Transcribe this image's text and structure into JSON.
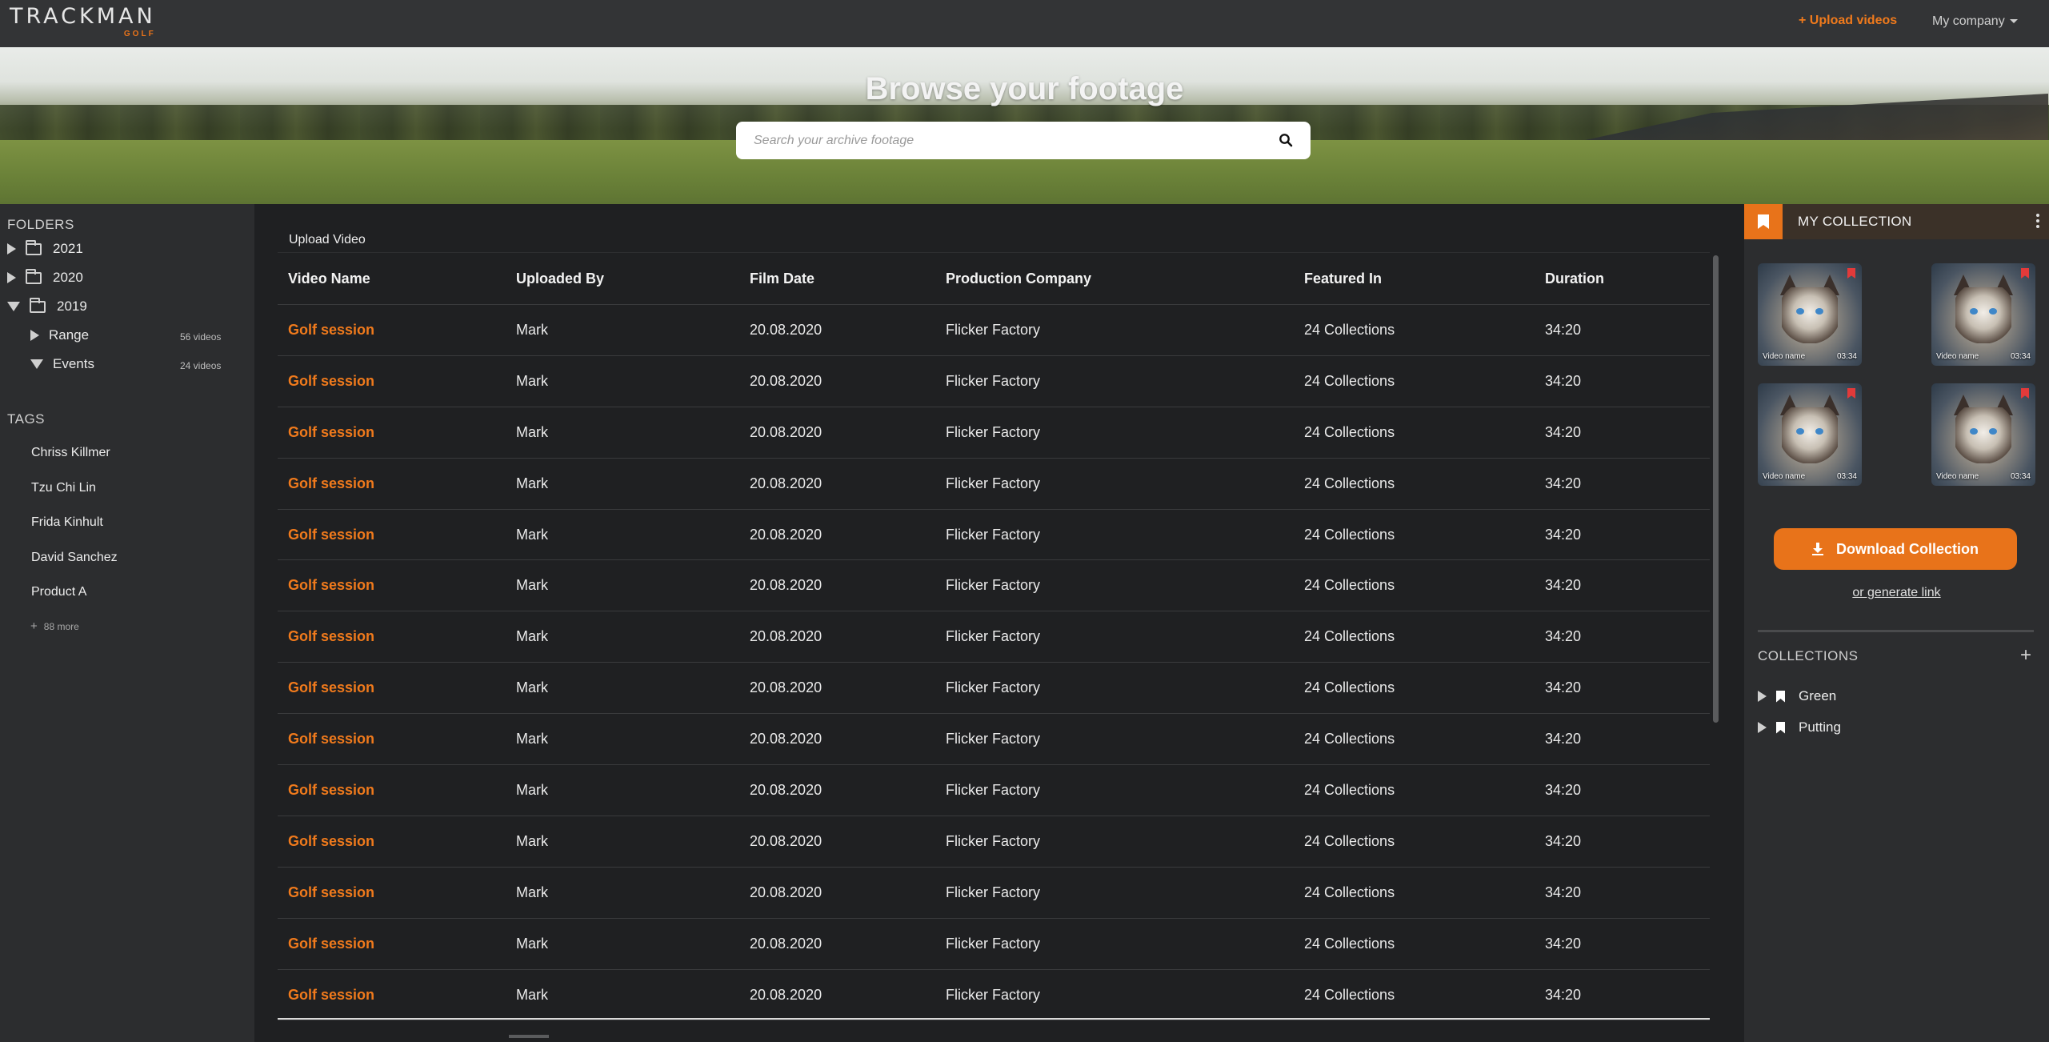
{
  "header": {
    "logo": "TRACKMAN",
    "logo_sub": "GOLF",
    "upload_label": "+ Upload videos",
    "company_label": "My company"
  },
  "hero": {
    "title": "Browse your footage",
    "search_placeholder": "Search your archive footage",
    "search_value": ""
  },
  "sidebar": {
    "folders_title": "FOLDERS",
    "folders": [
      {
        "label": "2021",
        "expanded": false
      },
      {
        "label": "2020",
        "expanded": false
      },
      {
        "label": "2019",
        "expanded": true
      }
    ],
    "subfolders": [
      {
        "label": "Range",
        "count": "56 videos",
        "expanded": false
      },
      {
        "label": "Events",
        "count": "24 videos",
        "expanded": true
      }
    ],
    "tags_title": "TAGS",
    "tags": [
      "Chriss Killmer",
      "Tzu Chi Lin",
      "Frida Kinhult",
      "David Sanchez",
      "Product A"
    ],
    "more_label": "88 more"
  },
  "main": {
    "upload_label": "Upload Video",
    "columns": [
      "Video Name",
      "Uploaded By",
      "Film Date",
      "Production Company",
      "Featured In",
      "Duration"
    ],
    "rows": [
      [
        "Golf session",
        "Mark",
        "20.08.2020",
        "Flicker Factory",
        "24 Collections",
        "34:20"
      ],
      [
        "Golf session",
        "Mark",
        "20.08.2020",
        "Flicker Factory",
        "24 Collections",
        "34:20"
      ],
      [
        "Golf session",
        "Mark",
        "20.08.2020",
        "Flicker Factory",
        "24 Collections",
        "34:20"
      ],
      [
        "Golf session",
        "Mark",
        "20.08.2020",
        "Flicker Factory",
        "24 Collections",
        "34:20"
      ],
      [
        "Golf session",
        "Mark",
        "20.08.2020",
        "Flicker Factory",
        "24 Collections",
        "34:20"
      ],
      [
        "Golf session",
        "Mark",
        "20.08.2020",
        "Flicker Factory",
        "24 Collections",
        "34:20"
      ],
      [
        "Golf session",
        "Mark",
        "20.08.2020",
        "Flicker Factory",
        "24 Collections",
        "34:20"
      ],
      [
        "Golf session",
        "Mark",
        "20.08.2020",
        "Flicker Factory",
        "24 Collections",
        "34:20"
      ],
      [
        "Golf session",
        "Mark",
        "20.08.2020",
        "Flicker Factory",
        "24 Collections",
        "34:20"
      ],
      [
        "Golf session",
        "Mark",
        "20.08.2020",
        "Flicker Factory",
        "24 Collections",
        "34:20"
      ],
      [
        "Golf session",
        "Mark",
        "20.08.2020",
        "Flicker Factory",
        "24 Collections",
        "34:20"
      ],
      [
        "Golf session",
        "Mark",
        "20.08.2020",
        "Flicker Factory",
        "24 Collections",
        "34:20"
      ],
      [
        "Golf session",
        "Mark",
        "20.08.2020",
        "Flicker Factory",
        "24 Collections",
        "34:20"
      ],
      [
        "Golf session",
        "Mark",
        "20.08.2020",
        "Flicker Factory",
        "24 Collections",
        "34:20"
      ]
    ]
  },
  "my_collection": {
    "title": "MY COLLECTION",
    "videos": [
      {
        "name": "Video name",
        "duration": "03:34"
      },
      {
        "name": "Video name",
        "duration": "03:34"
      },
      {
        "name": "Video name",
        "duration": "03:34"
      },
      {
        "name": "Video name",
        "duration": "03:34"
      }
    ],
    "download_label": "Download Collection",
    "generate_label": "or generate link",
    "collections_title": "COLLECTIONS",
    "collections": [
      "Green",
      "Putting"
    ]
  },
  "colors": {
    "accent": "#e8731a",
    "background": "#1e1f21",
    "sidebar": "#2c2d2f",
    "topbar": "#333436"
  }
}
